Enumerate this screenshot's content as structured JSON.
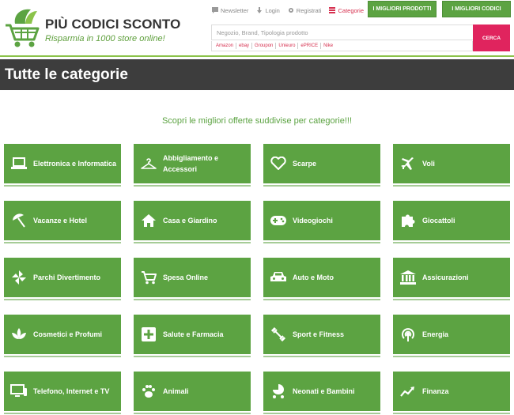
{
  "brand": {
    "title": "PIÙ CODICI SCONTO",
    "tagline": "Risparmia in 1000 store online!"
  },
  "topnav": [
    {
      "label": "Newsletter",
      "icon": "chat-icon",
      "active": false
    },
    {
      "label": "Login",
      "icon": "login-icon",
      "active": false
    },
    {
      "label": "Registrati",
      "icon": "gear-icon",
      "active": false
    },
    {
      "label": "Categorie",
      "icon": "list-icon",
      "active": true
    }
  ],
  "header_buttons": {
    "prodotti": "I MIGLIORI PRODOTTI",
    "codici": "I MIGLIORI CODICI"
  },
  "search": {
    "placeholder": "Negozio, Brand, Tipologia prodotto",
    "button": "CERCA",
    "quick_links": [
      "Amazon",
      "ebay",
      "Groupon",
      "Unieuro",
      "ePRICE",
      "Nike"
    ]
  },
  "page": {
    "title": "Tutte le categorie",
    "subtitle": "Scopri le migliori offerte suddivise per categorie!!!"
  },
  "colors": {
    "accent": "#5ca342",
    "accent_text": "#5ca342",
    "search_button": "#e0245e",
    "title_bar": "#3d3d3d",
    "active_link": "#d6304f"
  },
  "categories": [
    {
      "label": "Elettronica e Informatica",
      "icon": "laptop-icon"
    },
    {
      "label": "Abbigliamento e Accessori",
      "icon": "hanger-icon"
    },
    {
      "label": "Scarpe",
      "icon": "heart-icon"
    },
    {
      "label": "Voli",
      "icon": "plane-icon"
    },
    {
      "label": "Vacanze e Hotel",
      "icon": "beach-umbrella-icon"
    },
    {
      "label": "Casa e Giardino",
      "icon": "home-icon"
    },
    {
      "label": "Videogiochi",
      "icon": "gamepad-icon"
    },
    {
      "label": "Giocattoli",
      "icon": "puzzle-icon"
    },
    {
      "label": "Parchi Divertimento",
      "icon": "pinwheel-icon"
    },
    {
      "label": "Spesa Online",
      "icon": "cart-icon"
    },
    {
      "label": "Auto e Moto",
      "icon": "car-icon"
    },
    {
      "label": "Assicurazioni",
      "icon": "bank-icon"
    },
    {
      "label": "Cosmetici e Profumi",
      "icon": "lotus-icon"
    },
    {
      "label": "Salute e Farmacia",
      "icon": "medical-cross-icon"
    },
    {
      "label": "Sport e Fitness",
      "icon": "dumbbell-icon"
    },
    {
      "label": "Energia",
      "icon": "signal-icon"
    },
    {
      "label": "Telefono, Internet e TV",
      "icon": "monitor-icon"
    },
    {
      "label": "Animali",
      "icon": "paw-icon"
    },
    {
      "label": "Neonati e Bambini",
      "icon": "stroller-icon"
    },
    {
      "label": "Finanza",
      "icon": "trend-line-icon"
    }
  ]
}
